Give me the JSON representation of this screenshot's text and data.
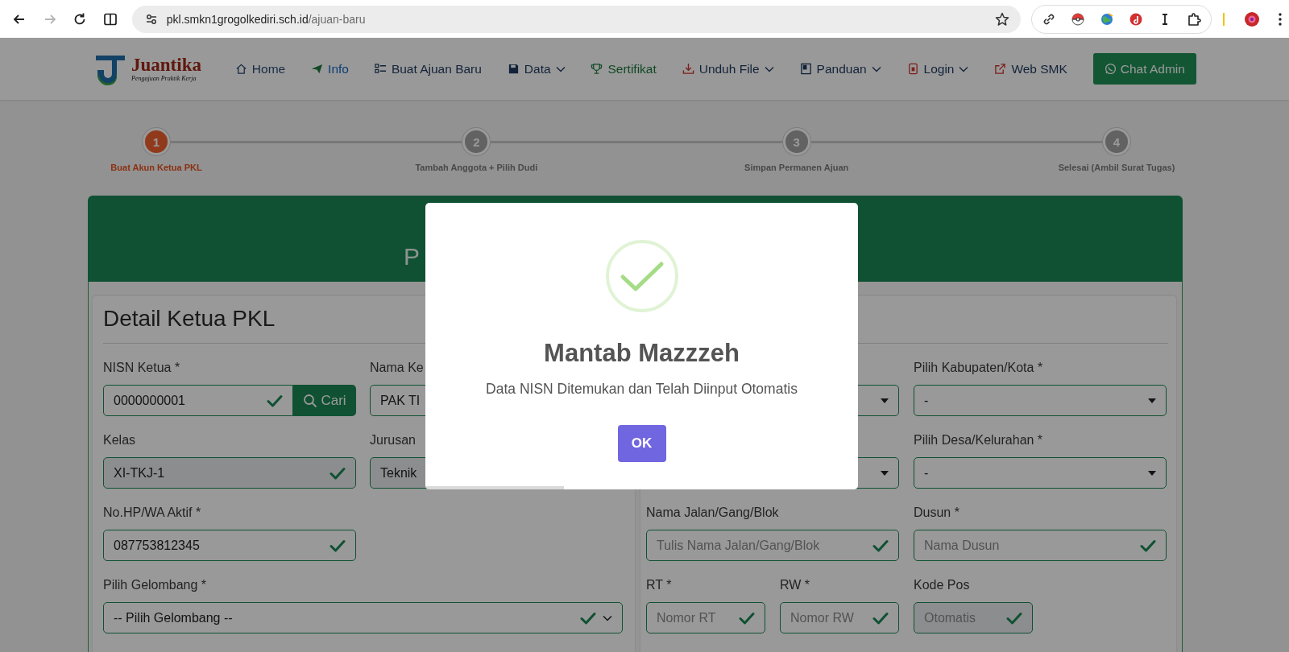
{
  "browser": {
    "nav_buttons": [
      {
        "kind": "back",
        "disabled": false
      },
      {
        "kind": "forward",
        "disabled": true
      },
      {
        "kind": "reload",
        "disabled": false
      },
      {
        "kind": "split",
        "disabled": false
      }
    ],
    "url": {
      "host": "pkl.smkn1grogolkediri.sch.id",
      "path": "/ajuan-baru"
    },
    "extensions": [
      {
        "kind": "link"
      },
      {
        "kind": "ball"
      },
      {
        "kind": "globe"
      },
      {
        "kind": "badge"
      },
      {
        "kind": "cursor"
      },
      {
        "kind": "puzzle"
      }
    ]
  },
  "site": {
    "logo": {
      "name": "Juantika",
      "tagline": "Pengajuan Praktik Kerja"
    },
    "nav": [
      {
        "label": "Home",
        "dropdown": false
      },
      {
        "label": "Info",
        "dropdown": false
      },
      {
        "label": "Buat Ajuan Baru",
        "dropdown": false
      },
      {
        "label": "Data",
        "dropdown": true
      },
      {
        "label": "Sertifikat",
        "dropdown": false
      },
      {
        "label": "Unduh File",
        "dropdown": true
      },
      {
        "label": "Panduan",
        "dropdown": true
      },
      {
        "label": "Login",
        "dropdown": true
      },
      {
        "label": "Web SMK",
        "dropdown": false
      }
    ],
    "chat_button": "Chat Admin"
  },
  "steps": [
    {
      "number": "1",
      "label": "Buat Akun Ketua PKL",
      "current": true
    },
    {
      "number": "2",
      "label": "Tambah Anggota + Pilih Dudi",
      "current": false
    },
    {
      "number": "3",
      "label": "Simpan Permanen Ajuan",
      "current": false
    },
    {
      "number": "4",
      "label": "Selesai (Ambil Surat Tugas)",
      "current": false
    }
  ],
  "form": {
    "header_fragments": [
      "P"
    ],
    "ketua": {
      "title": "Detail Ketua PKL",
      "fields": [
        {
          "kind": "search",
          "label": "NISN Ketua *",
          "value": "0000000001",
          "valid": true,
          "readonly": false,
          "button": "Cari"
        },
        {
          "kind": "input",
          "label": "Nama Ke",
          "value": "PAK TI",
          "readonly": false
        },
        {
          "kind": "input",
          "label": "Kelas",
          "value": "XI-TKJ-1",
          "valid": true,
          "readonly": true
        },
        {
          "kind": "input",
          "label": "Jurusan",
          "value": "Teknik",
          "readonly": true
        },
        {
          "kind": "input",
          "label": "No.HP/WA Aktif *",
          "value": "087753812345",
          "valid": true,
          "readonly": false
        },
        {
          "kind": "select",
          "label": "Pilih Gelombang *",
          "value": "-- Pilih Gelombang --",
          "valid": true,
          "readonly": false
        }
      ]
    },
    "alamat": {
      "fields": [
        {
          "kind": "dropdown"
        },
        {
          "kind": "dropdown",
          "label": "Pilih Kabupaten/Kota *",
          "value": "-"
        },
        {
          "kind": "dropdown"
        },
        {
          "kind": "dropdown",
          "label": "Pilih Desa/Kelurahan *",
          "value": "-"
        },
        {
          "kind": "input",
          "label": "Nama Jalan/Gang/Blok",
          "placeholder": "Tulis Nama Jalan/Gang/Blok",
          "valid": true,
          "readonly": false
        },
        {
          "kind": "input",
          "label": "Dusun *",
          "placeholder": "Nama Dusun",
          "valid": true,
          "readonly": false
        },
        {
          "kind": "short",
          "label": "RT *",
          "placeholder": "Nomor RT",
          "valid": true,
          "readonly": false
        },
        {
          "kind": "short",
          "label": "RW *",
          "placeholder": "Nomor RW",
          "valid": true,
          "readonly": false
        },
        {
          "kind": "short",
          "label": "Kode Pos",
          "placeholder": "Otomatis",
          "valid": true,
          "readonly": true
        }
      ]
    }
  },
  "modal": {
    "kind": "success",
    "title": "Mantab Mazzzeh",
    "text": "Data NISN Ditemukan dan Telah Diinput Otomatis",
    "button": "OK",
    "timer": {
      "level": 0.32
    }
  }
}
